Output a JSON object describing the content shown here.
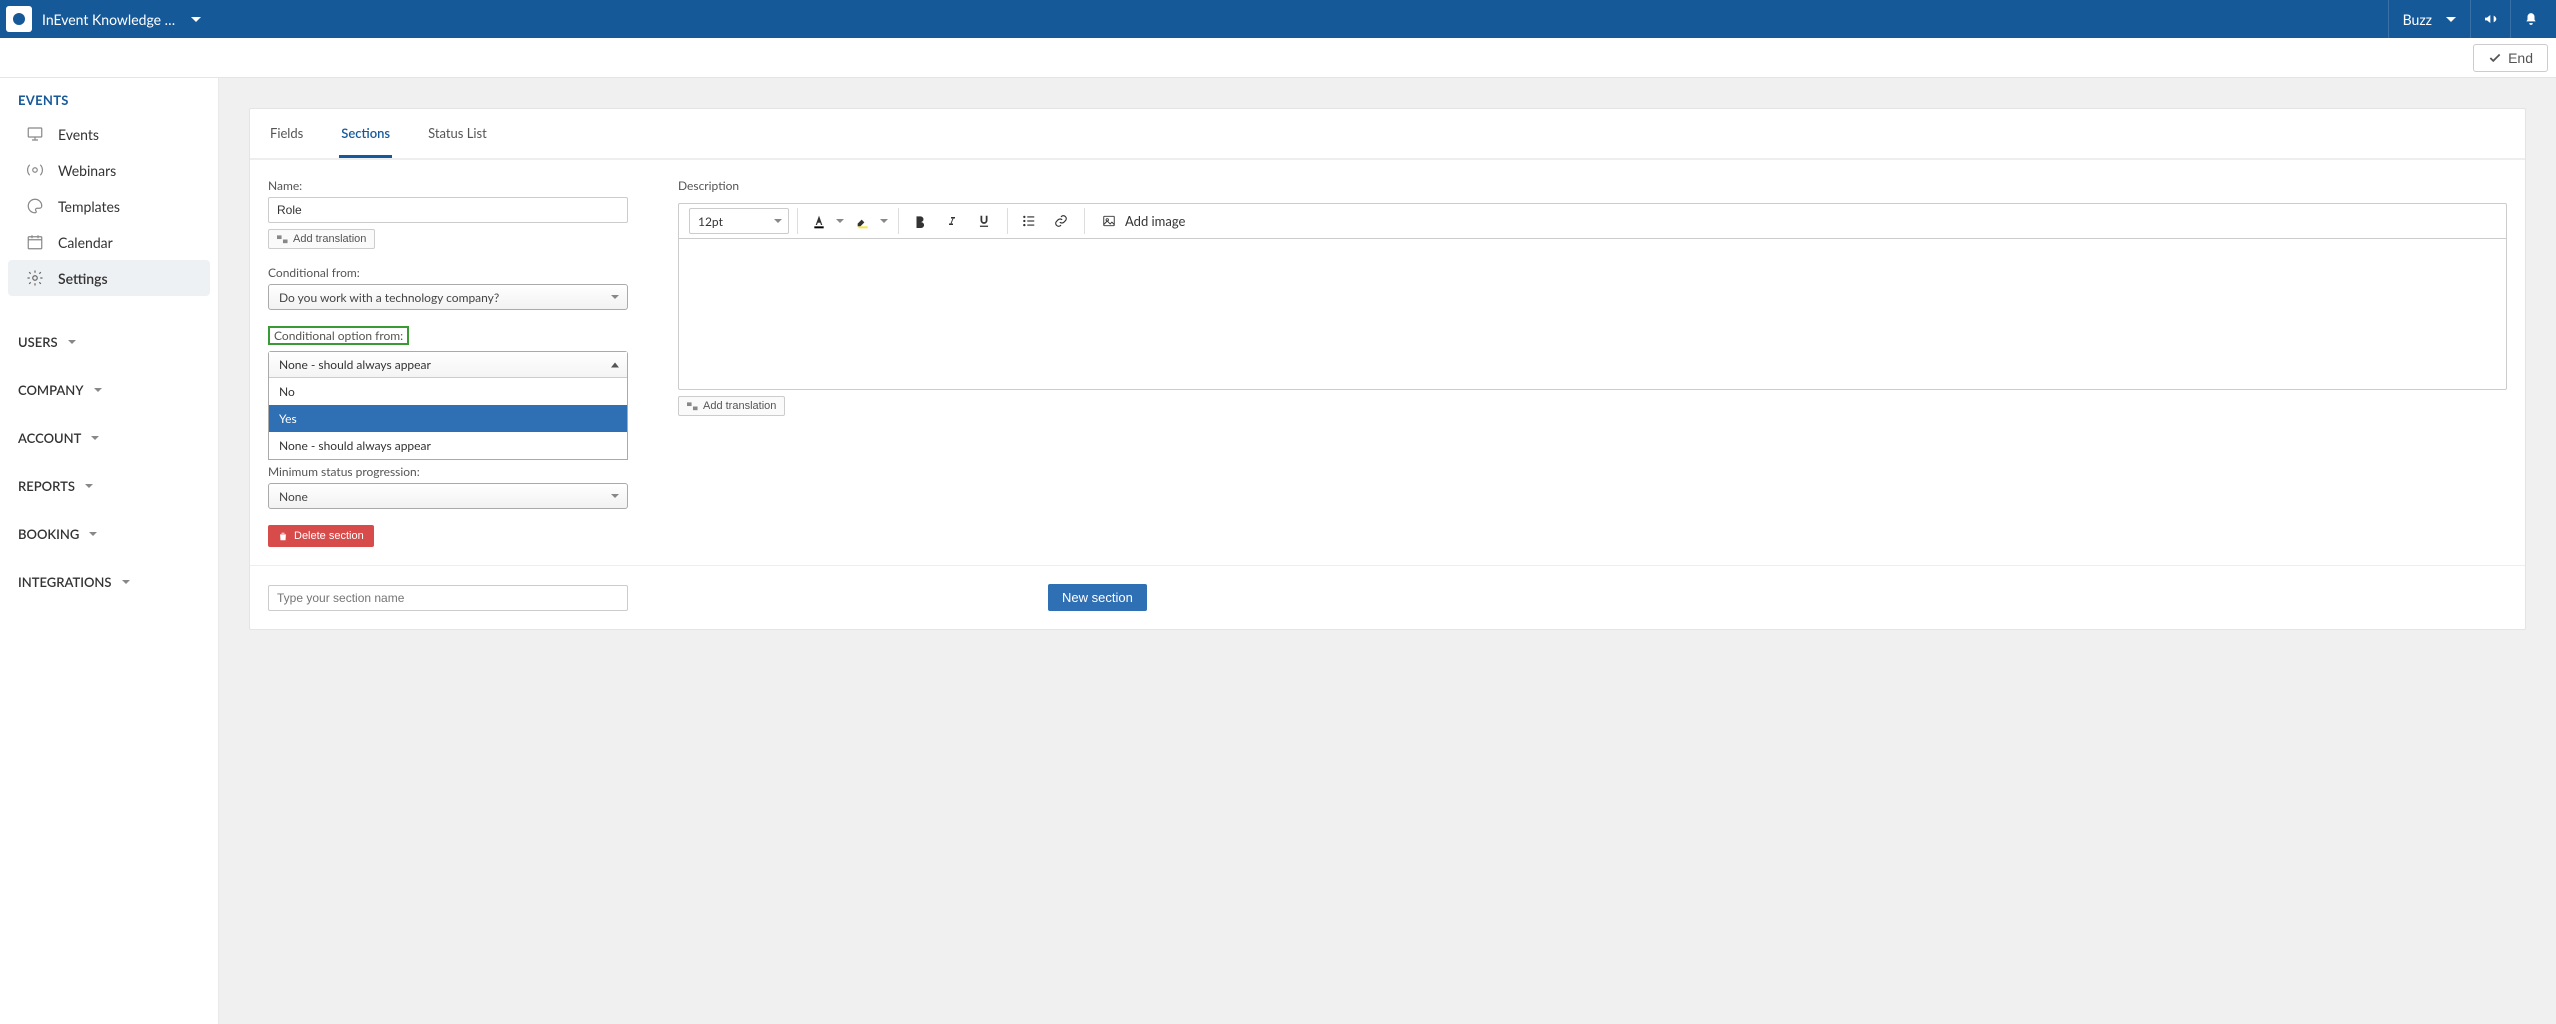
{
  "topbar": {
    "title": "InEvent Knowledge …",
    "user": "Buzz"
  },
  "endbar": {
    "end": "End"
  },
  "sidebar": {
    "heading": "EVENTS",
    "items": [
      {
        "label": "Events"
      },
      {
        "label": "Webinars"
      },
      {
        "label": "Templates"
      },
      {
        "label": "Calendar"
      },
      {
        "label": "Settings"
      }
    ],
    "groups": [
      {
        "label": "USERS"
      },
      {
        "label": "COMPANY"
      },
      {
        "label": "ACCOUNT"
      },
      {
        "label": "REPORTS"
      },
      {
        "label": "BOOKING"
      },
      {
        "label": "INTEGRATIONS"
      }
    ]
  },
  "tabs": {
    "fields": "Fields",
    "sections": "Sections",
    "status": "Status List"
  },
  "form": {
    "name_label": "Name:",
    "name_value": "Role",
    "add_translation": "Add translation",
    "cond_from_label": "Conditional from:",
    "cond_from_value": "Do you work with a technology company?",
    "cond_option_label": "Conditional option from:",
    "cond_option_current": "None - should always appear",
    "cond_option_choices": {
      "no": "No",
      "yes": "Yes",
      "none": "None - should always appear"
    },
    "min_status_label": "Minimum status progression:",
    "min_status_value": "None",
    "delete_section": "Delete section",
    "new_section_placeholder": "Type your section name",
    "new_section_btn": "New section"
  },
  "desc": {
    "label": "Description",
    "fontsize": "12pt",
    "add_image": "Add image",
    "add_translation": "Add translation"
  }
}
